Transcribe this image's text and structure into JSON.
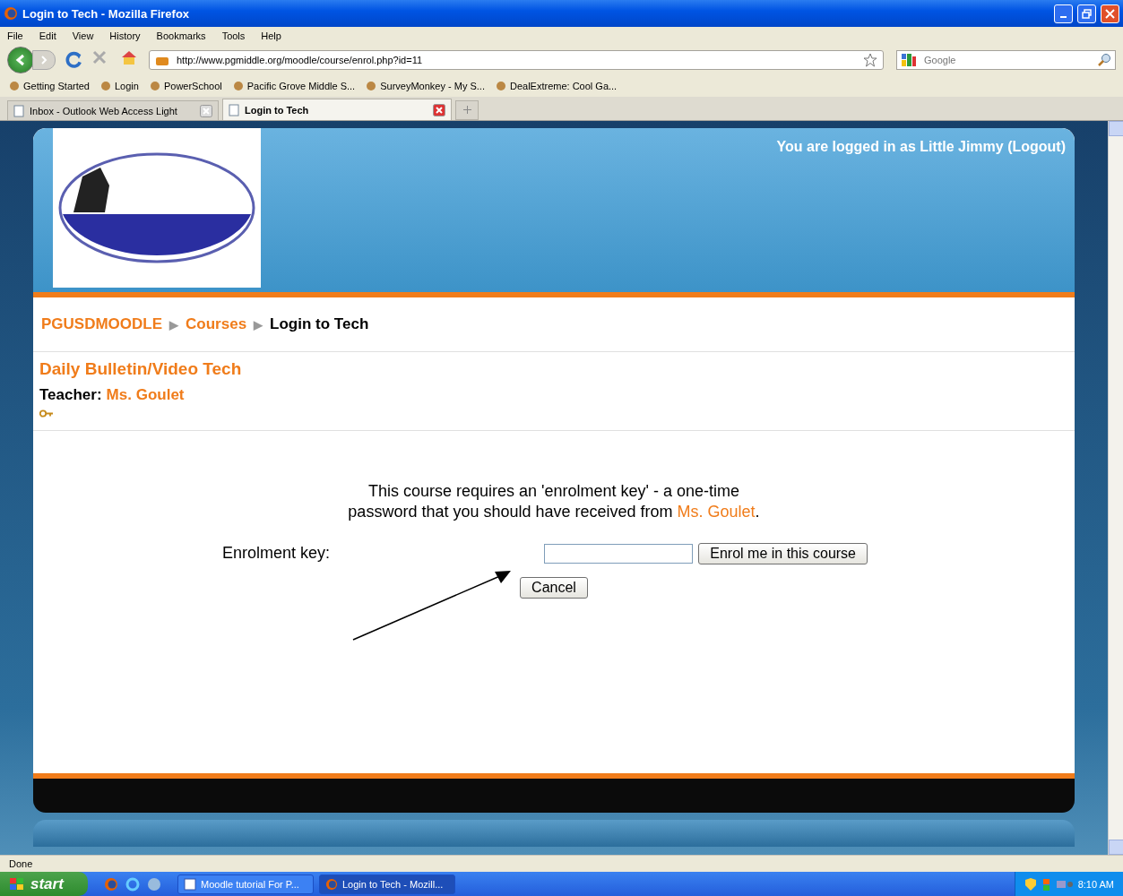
{
  "window": {
    "title": "Login to Tech - Mozilla Firefox"
  },
  "menu": [
    "File",
    "Edit",
    "View",
    "History",
    "Bookmarks",
    "Tools",
    "Help"
  ],
  "address": {
    "value": "http://www.pgmiddle.org/moodle/course/enrol.php?id=11"
  },
  "search": {
    "placeholder": "Google"
  },
  "bookmarks": [
    "Getting Started",
    "Login",
    "PowerSchool",
    "Pacific Grove Middle S...",
    "SurveyMonkey - My S...",
    "DealExtreme: Cool Ga..."
  ],
  "tabs": [
    {
      "label": "Inbox - Outlook Web Access Light",
      "selected": false
    },
    {
      "label": "Login to Tech",
      "selected": true
    }
  ],
  "page": {
    "login_text": "You are logged in as Little Jimmy",
    "logout_link": "(Logout)",
    "breadcrumb": [
      {
        "label": "PGUSDMOODLE",
        "kind": "link"
      },
      {
        "label": "▶",
        "kind": "separator"
      },
      {
        "label": "Courses",
        "kind": "link"
      },
      {
        "label": "▶",
        "kind": "separator"
      },
      {
        "label": "Login to Tech",
        "kind": "current"
      }
    ],
    "course_title": "Daily Bulletin/Video Tech",
    "teacher_label": "Teacher:",
    "teacher_name": "Ms. Goulet",
    "notice": {
      "before": "This course requires an 'enrolment key' - a one-time password that you should have received from",
      "link": "Ms. Goulet",
      "after": "."
    },
    "key_label": "Enrolment key:",
    "enrol_button": "Enrol me in this course",
    "cancel_button": "Cancel"
  },
  "status": "Done",
  "taskbar": {
    "start": "start",
    "tasks": [
      {
        "label": "Moodle tutorial For P...",
        "selected": false
      },
      {
        "label": "Login to Tech - Mozill...",
        "selected": true
      }
    ],
    "time": "8:10 AM"
  }
}
